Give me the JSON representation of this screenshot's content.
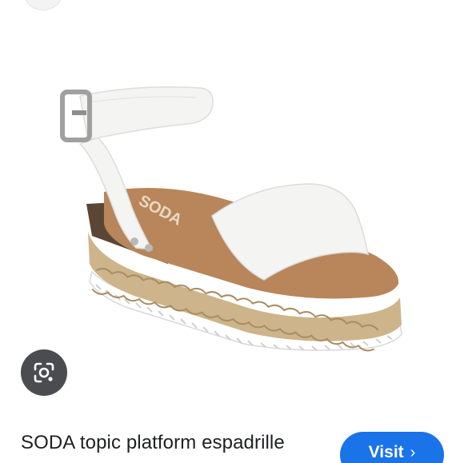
{
  "result": {
    "title": "SODA topic platform espadrille",
    "image_brand_text": "SODA",
    "visit_label": "Visit",
    "visit_icon": "chevron-right-icon",
    "lens_icon": "google-lens-icon",
    "colors": {
      "visit_button": "#1a73e8",
      "lens_button": "#4a4c4f",
      "text": "#202124",
      "sandal_leather": "#f4f4f2",
      "footbed": "#b8865a",
      "jute": "#cdb48a",
      "sole": "#ffffff"
    }
  }
}
